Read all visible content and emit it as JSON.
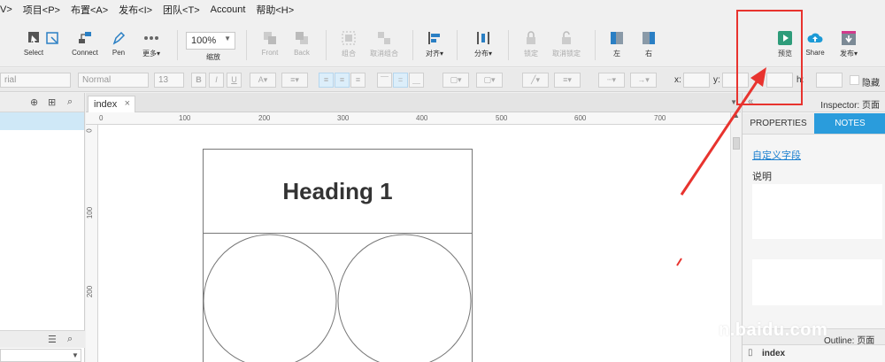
{
  "menu": [
    {
      "label": "V>"
    },
    {
      "label": "项目<P>"
    },
    {
      "label": "布置<A>"
    },
    {
      "label": "发布<I>"
    },
    {
      "label": "团队<T>"
    },
    {
      "label": "Account"
    },
    {
      "label": "帮助<H>"
    }
  ],
  "toolbar": {
    "select": "Select",
    "connect": "Connect",
    "pen": "Pen",
    "more": "更多▾",
    "zoom_value": "100%",
    "zoom_label": "缩放",
    "front": "Front",
    "back": "Back",
    "group": "组合",
    "ungroup": "取消组合",
    "align": "对齐▾",
    "distribute": "分布▾",
    "lock": "锁定",
    "unlock": "取消锁定",
    "left": "左",
    "right": "右",
    "preview": "预览",
    "share": "Share",
    "publish": "发布▾"
  },
  "format": {
    "font": "rial",
    "style": "Normal",
    "size": "13",
    "bold": "B",
    "italic": "I",
    "underline": "U",
    "x_label": "x:",
    "y_label": "y:",
    "h_label": "h:",
    "hidden_label": "隐藏"
  },
  "tabs": {
    "active": "index",
    "close": "×"
  },
  "ruler": {
    "h": [
      "0",
      "100",
      "200",
      "300",
      "400",
      "500",
      "600",
      "700"
    ],
    "v": [
      "0",
      "100",
      "200"
    ]
  },
  "wireframe": {
    "heading": "Heading 1"
  },
  "inspector": {
    "title": "Inspector: 页面",
    "tab_properties": "PROPERTIES",
    "tab_notes": "NOTES",
    "custom_fields_link": "自定义字段",
    "notes_label": "说明",
    "outline_title": "Outline: 页面",
    "outline_item": "index"
  },
  "watermark": "n.baidu.com",
  "colors": {
    "accent": "#2a9cdc",
    "annotation": "#e8332e",
    "preview_green": "#2e9c7a",
    "share_blue": "#1c9ad6",
    "publish_pink": "#d23a8c"
  }
}
